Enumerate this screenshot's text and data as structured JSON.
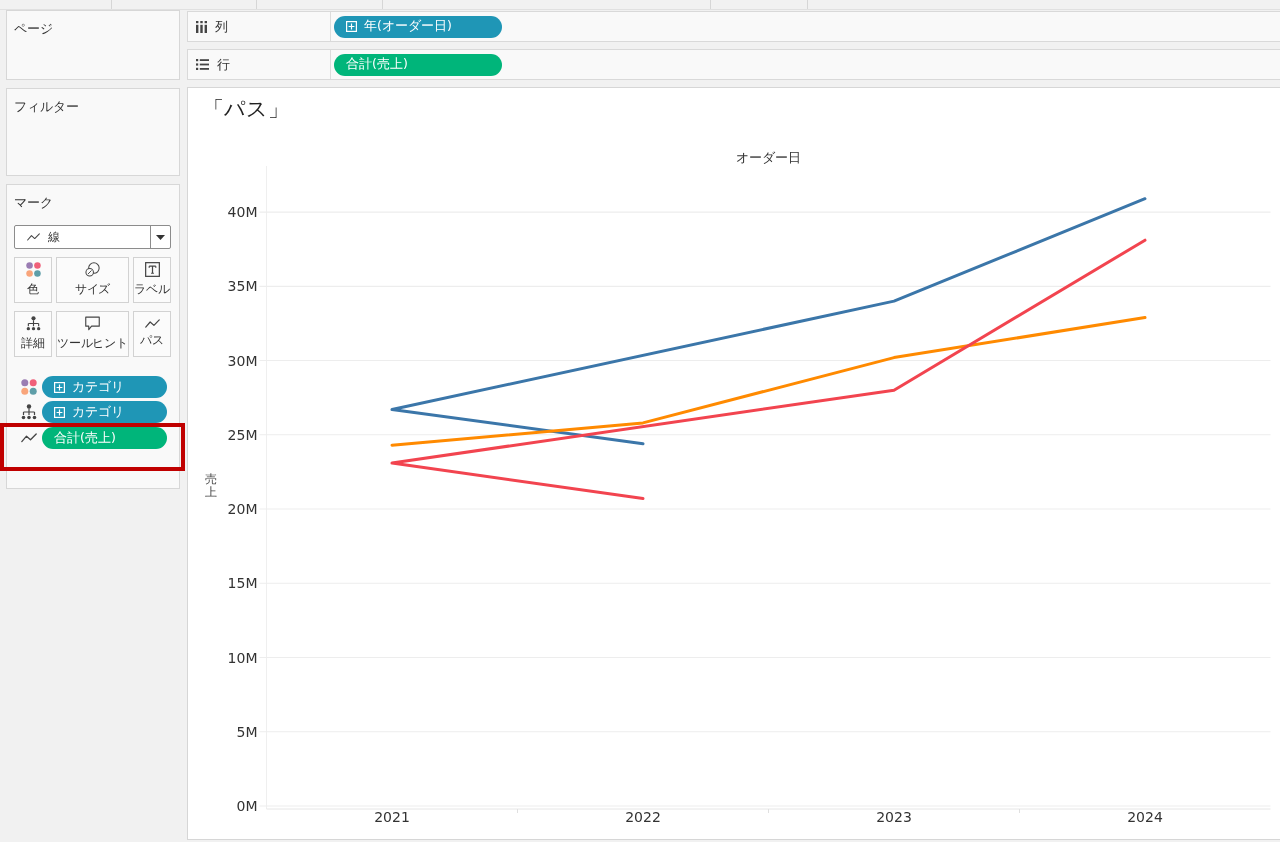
{
  "pages_card": {
    "title": "ページ"
  },
  "filters_card": {
    "title": "フィルター"
  },
  "marks_card": {
    "title": "マーク",
    "mark_type": {
      "kind": "line",
      "label": "線"
    },
    "properties": [
      {
        "kind": "color",
        "label": "色"
      },
      {
        "kind": "size",
        "label": "サイズ"
      },
      {
        "kind": "label",
        "label": "ラベル"
      },
      {
        "kind": "detail",
        "label": "詳細"
      },
      {
        "kind": "tooltip",
        "label": "ツールヒント"
      },
      {
        "kind": "path",
        "label": "パス"
      }
    ],
    "fields": [
      {
        "kind": "color",
        "label": "カテゴリ",
        "color": "#1f96b6",
        "expandable": true,
        "highlighted": false
      },
      {
        "kind": "detail",
        "label": "カテゴリ",
        "color": "#1f96b6",
        "expandable": true,
        "highlighted": false
      },
      {
        "kind": "path",
        "label": "合計(売上)",
        "color": "#00b57a",
        "expandable": false,
        "highlighted": true
      }
    ]
  },
  "shelves": [
    {
      "kind": "columns",
      "label": "列",
      "pills": [
        {
          "label": "年(オーダー日)",
          "color": "#1f96b6",
          "expandable": true
        }
      ]
    },
    {
      "kind": "rows",
      "label": "行",
      "pills": [
        {
          "label": "合計(売上)",
          "color": "#00b57a",
          "expandable": false
        }
      ]
    }
  ],
  "view": {
    "title": "「パス」",
    "chart_data": {
      "type": "line",
      "xlabel": "オーダー日",
      "ylabel": "売上",
      "grid": true,
      "xlim": [
        2020.5,
        2024.5
      ],
      "ylim": [
        0,
        43.1
      ],
      "xticks": [
        {
          "value": 2021,
          "label": "2021"
        },
        {
          "value": 2022,
          "label": "2022"
        },
        {
          "value": 2023,
          "label": "2023"
        },
        {
          "value": 2024,
          "label": "2024"
        }
      ],
      "yticks": [
        {
          "value": 0,
          "label": "0M"
        },
        {
          "value": 5,
          "label": "5M"
        },
        {
          "value": 10,
          "label": "10M"
        },
        {
          "value": 15,
          "label": "15M"
        },
        {
          "value": 20,
          "label": "20M"
        },
        {
          "value": 25,
          "label": "25M"
        },
        {
          "value": 30,
          "label": "30M"
        },
        {
          "value": 35,
          "label": "35M"
        },
        {
          "value": 40,
          "label": "40M"
        }
      ],
      "series": [
        {
          "color": "#3b76a9",
          "x": [
            2022,
            2021,
            2023,
            2024
          ],
          "values": [
            24.4,
            26.7,
            34.0,
            40.9
          ]
        },
        {
          "color": "#ff8a00",
          "x": [
            2021,
            2022,
            2023,
            2024
          ],
          "values": [
            24.3,
            25.8,
            30.2,
            32.9
          ]
        },
        {
          "color": "#f2444f",
          "x": [
            2022,
            2021,
            2023,
            2024
          ],
          "values": [
            20.7,
            23.1,
            28.0,
            38.1
          ]
        }
      ]
    }
  }
}
